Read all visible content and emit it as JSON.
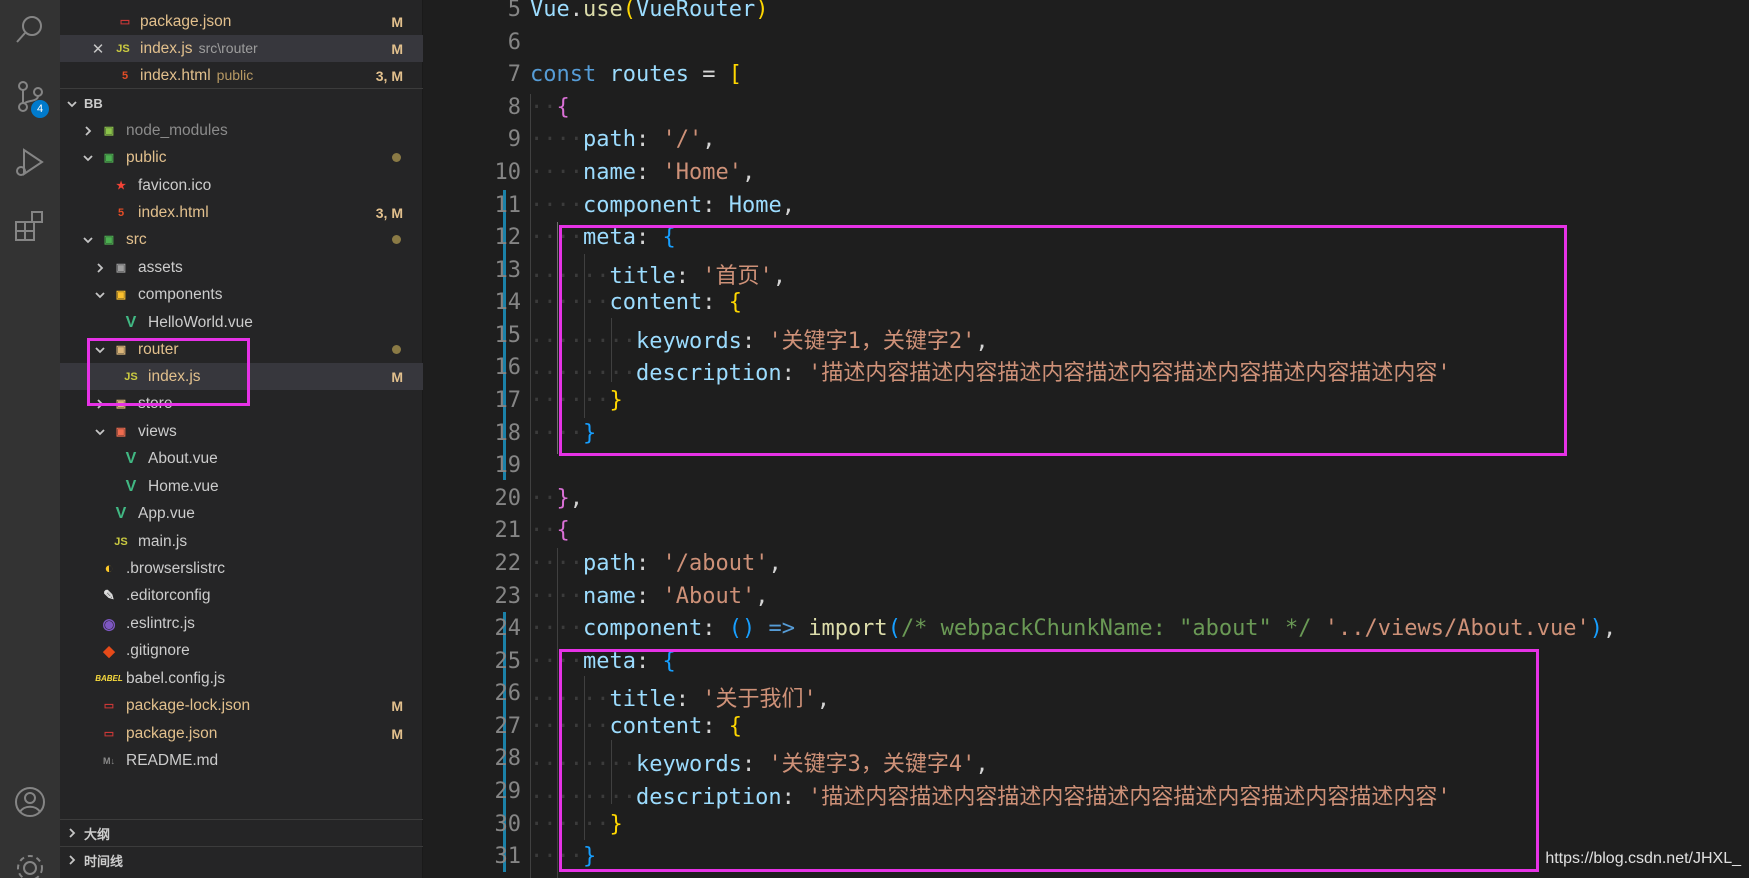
{
  "explorer": {
    "open_editors": [
      {
        "name": "package.json",
        "icon": "npm-icon",
        "status": "M"
      },
      {
        "name": "index.js",
        "desc": "src\\router",
        "icon": "js-icon",
        "status": "M"
      },
      {
        "name": "index.html",
        "desc": "public",
        "icon": "html-icon",
        "status": "3, M"
      }
    ],
    "project": "BB",
    "tree": [
      {
        "name": "node_modules"
      },
      {
        "name": "public"
      },
      {
        "name": "favicon.ico"
      },
      {
        "name": "index.html",
        "status": "3, M"
      },
      {
        "name": "src"
      },
      {
        "name": "assets"
      },
      {
        "name": "components"
      },
      {
        "name": "HelloWorld.vue"
      },
      {
        "name": "router"
      },
      {
        "name": "index.js",
        "status": "M"
      },
      {
        "name": "store"
      },
      {
        "name": "views"
      },
      {
        "name": "About.vue"
      },
      {
        "name": "Home.vue"
      },
      {
        "name": "App.vue"
      },
      {
        "name": "main.js"
      },
      {
        "name": ".browserslistrc"
      },
      {
        "name": ".editorconfig"
      },
      {
        "name": ".eslintrc.js"
      },
      {
        "name": ".gitignore"
      },
      {
        "name": "babel.config.js"
      },
      {
        "name": "package-lock.json",
        "status": "M"
      },
      {
        "name": "package.json",
        "status": "M"
      },
      {
        "name": "README.md"
      }
    ],
    "panels": [
      "大纲",
      "时间线"
    ]
  },
  "activity": {
    "source_control_badge": "4"
  },
  "editor": {
    "line_numbers": [
      "5",
      "6",
      "7",
      "8",
      "9",
      "10",
      "11",
      "12",
      "13",
      "14",
      "15",
      "16",
      "17",
      "18",
      "19",
      "20",
      "21",
      "22",
      "23",
      "24",
      "25",
      "26",
      "27",
      "28",
      "29",
      "30",
      "31"
    ],
    "strings": {
      "vue_router": "VueRouter",
      "root_path": "'/'",
      "home_name": "'Home'",
      "home_title": "'首页'",
      "home_keywords": "'关键字1，关键字2'",
      "home_description": "'描述内容描述内容描述内容描述内容描述内容描述内容描述内容'",
      "about_path": "'/about'",
      "about_name": "'About'",
      "chunk_comment": "/* webpackChunkName: \"about\" */",
      "about_import": "'../views/About.vue'",
      "about_title": "'关于我们'",
      "about_keywords": "'关键字3，关键字4'",
      "about_description": "'描述内容描述内容描述内容描述内容描述内容描述内容描述内容'"
    }
  },
  "watermark": "https://blog.csdn.net/JHXL_",
  "colors": {
    "highlight_box": "#e632e6",
    "modified": "#e2c08d",
    "accent": "#007acc"
  }
}
